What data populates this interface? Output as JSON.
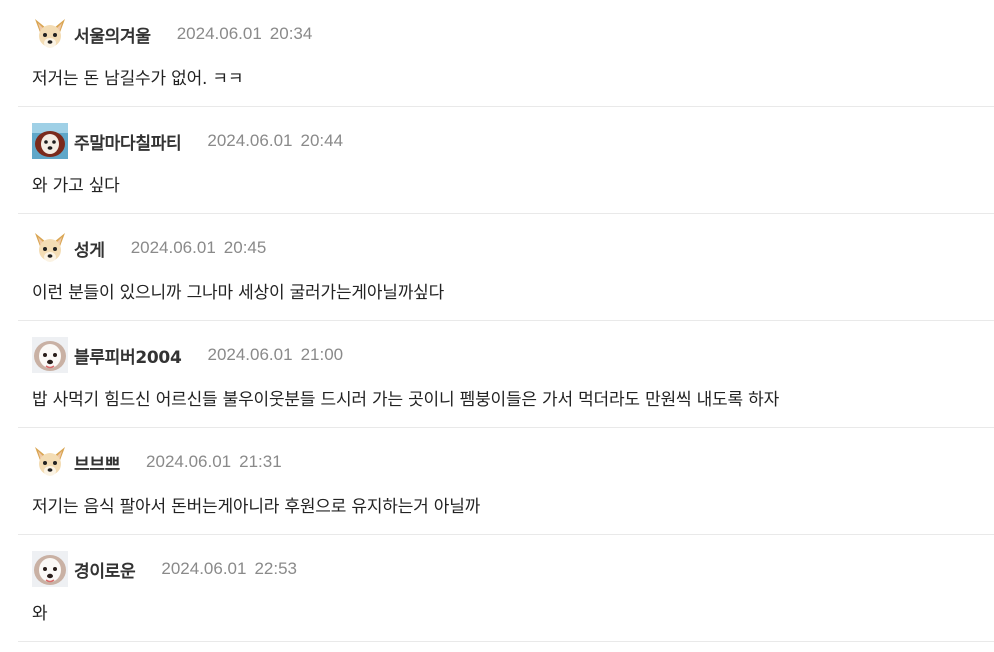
{
  "comments": [
    {
      "avatar_icon": "chihuahua-avatar-icon",
      "author": "서울의겨울",
      "date": "2024.06.01",
      "time": "20:34",
      "text": "저거는 돈 남길수가 없어. ㅋㅋ"
    },
    {
      "avatar_icon": "dog-photo-avatar-icon",
      "author": "주말마다칠파티",
      "date": "2024.06.01",
      "time": "20:44",
      "text": "와 가고 싶다"
    },
    {
      "avatar_icon": "chihuahua-avatar-icon",
      "author": "성게",
      "date": "2024.06.01",
      "time": "20:45",
      "text": "이런 분들이 있으니까 그나마 세상이 굴러가는게아닐까싶다"
    },
    {
      "avatar_icon": "white-dog-avatar-icon",
      "author": "블루피버2004",
      "date": "2024.06.01",
      "time": "21:00",
      "text": "밥 사먹기 힘드신 어르신들 불우이웃분들 드시러 가는 곳이니 펨붕이들은 가서 먹더라도 만원씩 내도록 하자"
    },
    {
      "avatar_icon": "chihuahua-avatar-icon",
      "author": "브브쁘",
      "date": "2024.06.01",
      "time": "21:31",
      "text": "저기는 음식 팔아서 돈버는게아니라 후원으로 유지하는거 아닐까"
    },
    {
      "avatar_icon": "white-dog-avatar-icon",
      "author": "경이로운",
      "date": "2024.06.01",
      "time": "22:53",
      "text": "와"
    }
  ]
}
